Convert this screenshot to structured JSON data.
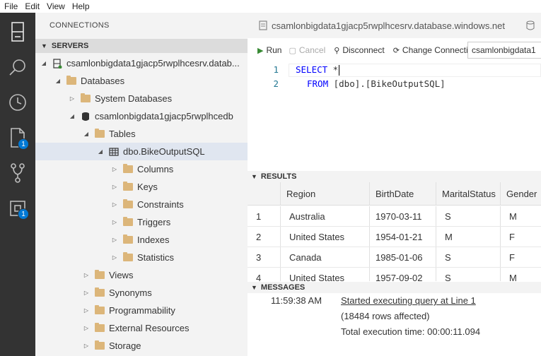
{
  "menu": [
    "File",
    "Edit",
    "View",
    "Help"
  ],
  "activity_bar": {
    "items": [
      {
        "icon": "server-icon",
        "badge": ""
      },
      {
        "icon": "search-icon",
        "badge": ""
      },
      {
        "icon": "history-icon",
        "badge": ""
      },
      {
        "icon": "file-icon",
        "badge": "1"
      },
      {
        "icon": "source-control-icon",
        "badge": ""
      },
      {
        "icon": "extensions-icon",
        "badge": "1"
      }
    ]
  },
  "sidebar": {
    "title": "CONNECTIONS",
    "servers_header": "SERVERS",
    "tree": [
      {
        "label": "csamlonbigdata1gjacp5rwplhcesrv.datab...",
        "twisty": "◢",
        "icon": "server",
        "indent": 0
      },
      {
        "label": "Databases",
        "twisty": "◢",
        "icon": "folder",
        "indent": 1
      },
      {
        "label": "System Databases",
        "twisty": "▷",
        "icon": "folder",
        "indent": 2
      },
      {
        "label": "csamlonbigdata1gjacp5rwplhcedb",
        "twisty": "◢",
        "icon": "database",
        "indent": 2
      },
      {
        "label": "Tables",
        "twisty": "◢",
        "icon": "folder",
        "indent": 3
      },
      {
        "label": "dbo.BikeOutputSQL",
        "twisty": "◢",
        "icon": "table",
        "indent": 4,
        "selected": true
      },
      {
        "label": "Columns",
        "twisty": "▷",
        "icon": "folder",
        "indent": 5
      },
      {
        "label": "Keys",
        "twisty": "▷",
        "icon": "folder",
        "indent": 5
      },
      {
        "label": "Constraints",
        "twisty": "▷",
        "icon": "folder",
        "indent": 5
      },
      {
        "label": "Triggers",
        "twisty": "▷",
        "icon": "folder",
        "indent": 5
      },
      {
        "label": "Indexes",
        "twisty": "▷",
        "icon": "folder",
        "indent": 5
      },
      {
        "label": "Statistics",
        "twisty": "▷",
        "icon": "folder",
        "indent": 5
      },
      {
        "label": "Views",
        "twisty": "▷",
        "icon": "folder",
        "indent": 3
      },
      {
        "label": "Synonyms",
        "twisty": "▷",
        "icon": "folder",
        "indent": 3
      },
      {
        "label": "Programmability",
        "twisty": "▷",
        "icon": "folder",
        "indent": 3
      },
      {
        "label": "External Resources",
        "twisty": "▷",
        "icon": "folder",
        "indent": 3
      },
      {
        "label": "Storage",
        "twisty": "▷",
        "icon": "folder",
        "indent": 3
      }
    ]
  },
  "editor": {
    "tab_title": "csamlonbigdata1gjacp5rwplhcesrv.database.windows.net",
    "toolbar": {
      "run": "Run",
      "cancel": "Cancel",
      "disconnect": "Disconnect",
      "change_connection": "Change Connection",
      "connection_value": "csamlonbigdata1"
    },
    "lines": [
      {
        "number": "1",
        "keyword": "SELECT",
        "rest": " *"
      },
      {
        "number": "2",
        "keyword": "FROM",
        "rest": " [dbo].[BikeOutputSQL]"
      }
    ]
  },
  "results": {
    "header": "RESULTS",
    "columns": [
      "",
      "Region",
      "BirthDate",
      "MaritalStatus",
      "Gender"
    ],
    "rows": [
      [
        "1",
        "Australia",
        "1970-03-11",
        "S",
        "M"
      ],
      [
        "2",
        "United States",
        "1954-01-21",
        "M",
        "F"
      ],
      [
        "3",
        "Canada",
        "1985-01-06",
        "S",
        "F"
      ],
      [
        "4",
        "United States",
        "1957-09-02",
        "S",
        "M"
      ]
    ]
  },
  "messages": {
    "header": "MESSAGES",
    "time": "11:59:38 AM",
    "started": "Started executing query at Line 1",
    "rows_affected": "(18484 rows affected)",
    "exec_time": "Total execution time: 00:00:11.094"
  }
}
